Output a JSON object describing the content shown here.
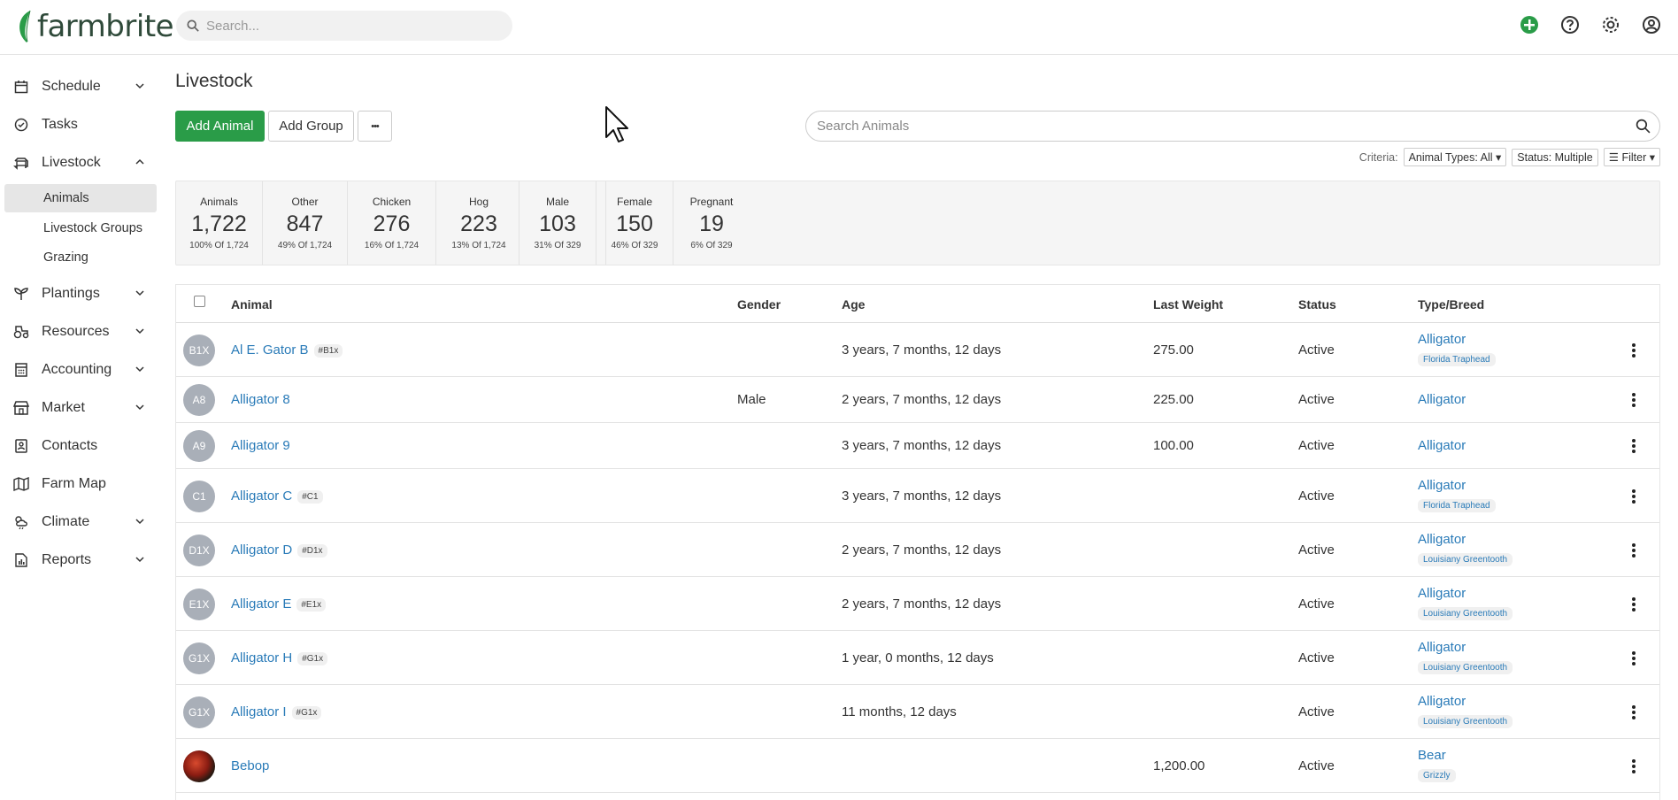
{
  "app": {
    "name": "farmbrite"
  },
  "search": {
    "placeholder": "Search..."
  },
  "topbar": {
    "icons": [
      "add-circle-icon",
      "help-icon",
      "settings-icon",
      "user-icon"
    ]
  },
  "sidebar": {
    "items": [
      {
        "label": "Schedule",
        "icon": "calendar-icon",
        "expandable": true
      },
      {
        "label": "Tasks",
        "icon": "check-circle-icon",
        "expandable": false
      },
      {
        "label": "Livestock",
        "icon": "livestock-icon",
        "expandable": true,
        "expanded": true
      },
      {
        "label": "Plantings",
        "icon": "seedling-icon",
        "expandable": true
      },
      {
        "label": "Resources",
        "icon": "tractor-icon",
        "expandable": true
      },
      {
        "label": "Accounting",
        "icon": "calculator-icon",
        "expandable": true
      },
      {
        "label": "Market",
        "icon": "store-icon",
        "expandable": true
      },
      {
        "label": "Contacts",
        "icon": "contacts-icon",
        "expandable": false
      },
      {
        "label": "Farm Map",
        "icon": "map-icon",
        "expandable": false
      },
      {
        "label": "Climate",
        "icon": "weather-icon",
        "expandable": true
      },
      {
        "label": "Reports",
        "icon": "report-icon",
        "expandable": true
      }
    ],
    "livestock_sub": [
      "Animals",
      "Livestock Groups",
      "Grazing"
    ]
  },
  "page": {
    "title": "Livestock",
    "add_animal": "Add Animal",
    "add_group": "Add Group",
    "more": "•••",
    "search_placeholder": "Search Animals",
    "criteria_label": "Criteria:",
    "criteria_types": "Animal Types: All",
    "criteria_status": "Status: Multiple",
    "criteria_filter": "Filter"
  },
  "stats": [
    {
      "label": "Animals",
      "value": "1,722",
      "sub": "100% Of 1,724"
    },
    {
      "label": "Other",
      "value": "847",
      "sub": "49% Of 1,724"
    },
    {
      "label": "Chicken",
      "value": "276",
      "sub": "16% Of 1,724"
    },
    {
      "label": "Hog",
      "value": "223",
      "sub": "13% Of 1,724"
    },
    {
      "label": "Male",
      "value": "103",
      "sub": "31% Of 329"
    },
    {
      "label": "Female",
      "value": "150",
      "sub": "46% Of 329"
    },
    {
      "label": "Pregnant",
      "value": "19",
      "sub": "6% Of 329"
    }
  ],
  "table": {
    "headers": {
      "animal": "Animal",
      "gender": "Gender",
      "age": "Age",
      "weight": "Last Weight",
      "status": "Status",
      "type": "Type/Breed"
    },
    "rows": [
      {
        "initials": "B1X",
        "name": "Al E. Gator B",
        "tag": "#B1x",
        "gender": "",
        "age": "3 years, 7 months, 12 days",
        "weight": "275.00",
        "status": "Active",
        "type": "Alligator",
        "breed": "Florida Traphead"
      },
      {
        "initials": "A8",
        "name": "Alligator 8",
        "tag": "",
        "gender": "Male",
        "age": "2 years, 7 months, 12 days",
        "weight": "225.00",
        "status": "Active",
        "type": "Alligator",
        "breed": ""
      },
      {
        "initials": "A9",
        "name": "Alligator 9",
        "tag": "",
        "gender": "",
        "age": "3 years, 7 months, 12 days",
        "weight": "100.00",
        "status": "Active",
        "type": "Alligator",
        "breed": ""
      },
      {
        "initials": "C1",
        "name": "Alligator C",
        "tag": "#C1",
        "gender": "",
        "age": "3 years, 7 months, 12 days",
        "weight": "",
        "status": "Active",
        "type": "Alligator",
        "breed": "Florida Traphead"
      },
      {
        "initials": "D1X",
        "name": "Alligator D",
        "tag": "#D1x",
        "gender": "",
        "age": "2 years, 7 months, 12 days",
        "weight": "",
        "status": "Active",
        "type": "Alligator",
        "breed": "Louisiany Greentooth"
      },
      {
        "initials": "E1X",
        "name": "Alligator E",
        "tag": "#E1x",
        "gender": "",
        "age": "2 years, 7 months, 12 days",
        "weight": "",
        "status": "Active",
        "type": "Alligator",
        "breed": "Louisiany Greentooth"
      },
      {
        "initials": "G1X",
        "name": "Alligator H",
        "tag": "#G1x",
        "gender": "",
        "age": "1 year, 0 months, 12 days",
        "weight": "",
        "status": "Active",
        "type": "Alligator",
        "breed": "Louisiany Greentooth"
      },
      {
        "initials": "G1X",
        "name": "Alligator I",
        "tag": "#G1x",
        "gender": "",
        "age": "11 months, 12 days",
        "weight": "",
        "status": "Active",
        "type": "Alligator",
        "breed": "Louisiany Greentooth"
      },
      {
        "initials": "",
        "name": "Bebop",
        "tag": "",
        "gender": "",
        "age": "",
        "weight": "1,200.00",
        "status": "Active",
        "type": "Bear",
        "breed": "Grizzly",
        "photo": true
      }
    ]
  },
  "colors": {
    "brand_green": "#2a9c48",
    "link_blue": "#2a7bb8"
  }
}
